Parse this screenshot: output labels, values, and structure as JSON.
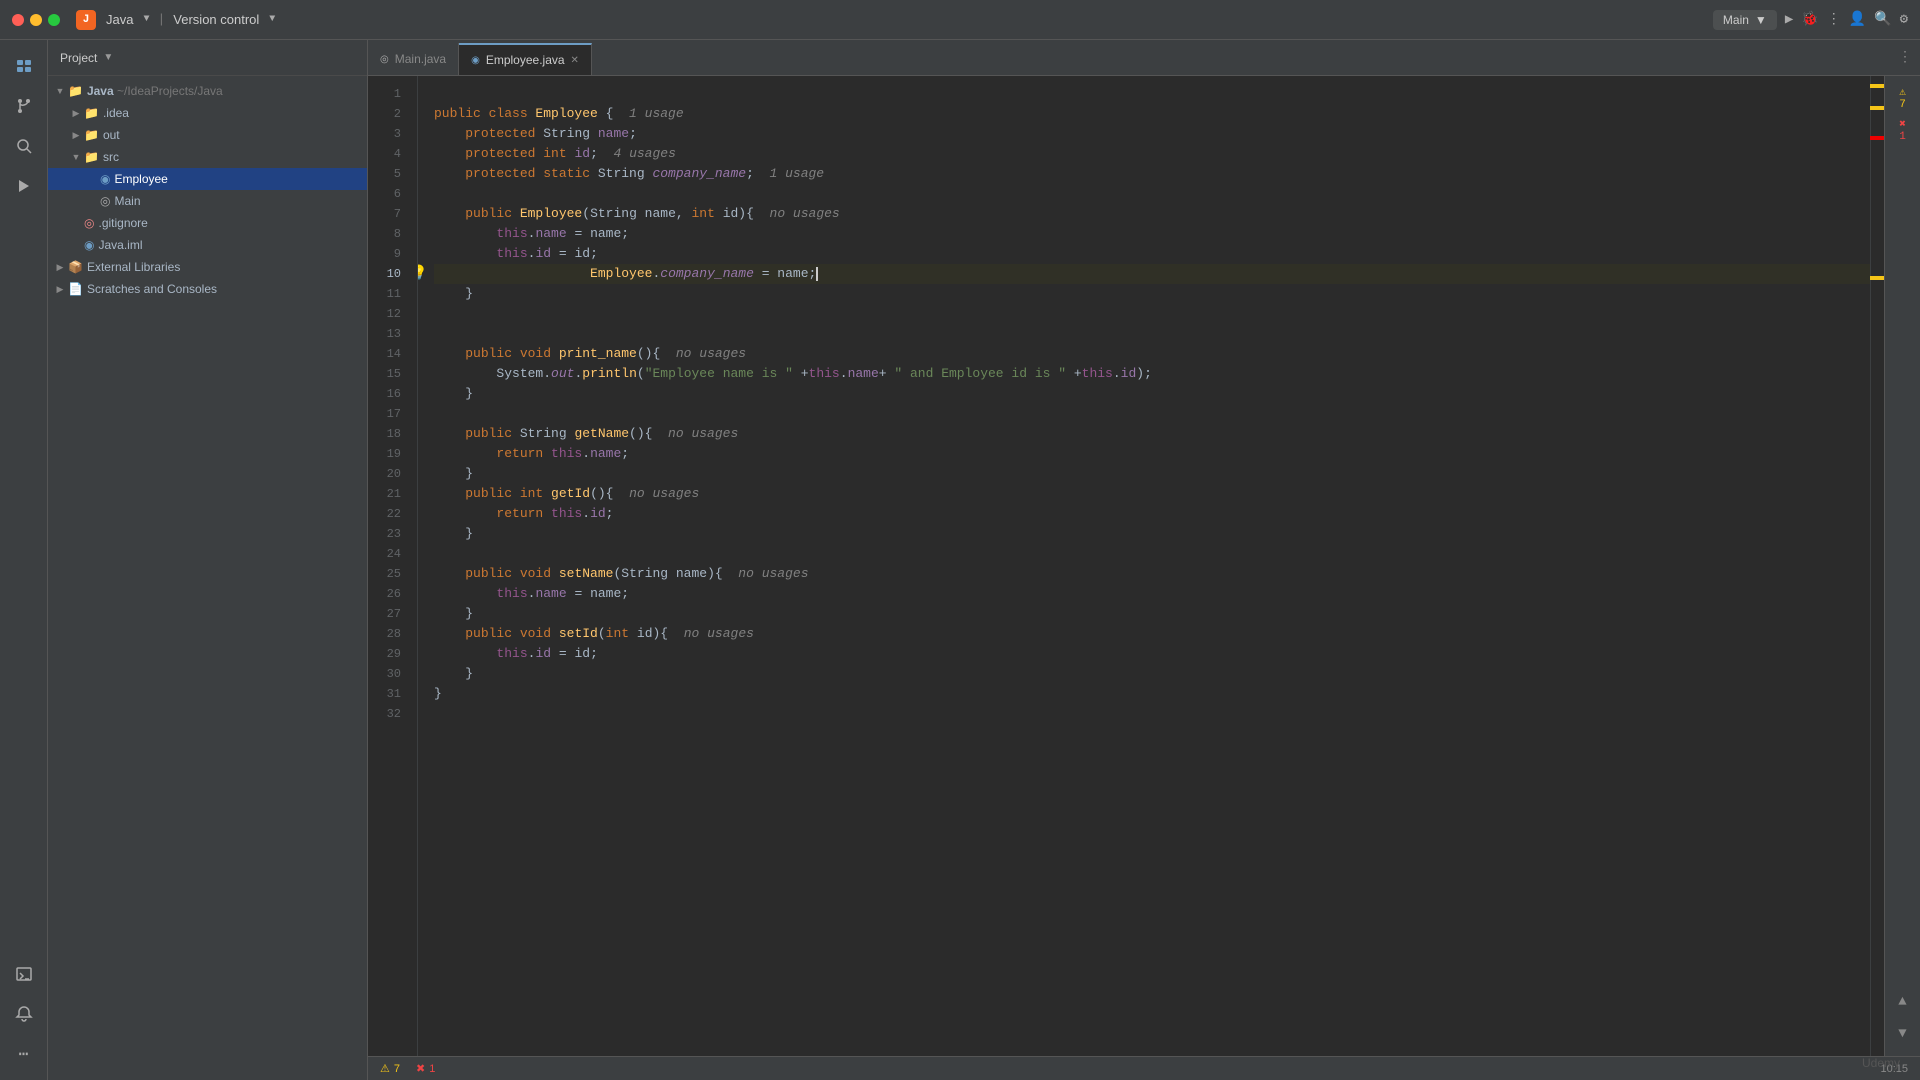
{
  "titlebar": {
    "app_icon": "J",
    "app_name": "Java",
    "version_control": "Version control",
    "branch": "Main",
    "run_label": "Main"
  },
  "project": {
    "title": "Project",
    "root": "Java",
    "root_path": "~/IdeaProjects/Java",
    "items": [
      {
        "label": ".idea",
        "type": "folder",
        "depth": 1,
        "expanded": false
      },
      {
        "label": "out",
        "type": "folder",
        "depth": 1,
        "expanded": false
      },
      {
        "label": "src",
        "type": "folder",
        "depth": 1,
        "expanded": true,
        "selected": false
      },
      {
        "label": "Employee",
        "type": "java",
        "depth": 2,
        "selected": true
      },
      {
        "label": "Main",
        "type": "java",
        "depth": 2,
        "selected": false
      },
      {
        "label": ".gitignore",
        "type": "git",
        "depth": 1,
        "selected": false
      },
      {
        "label": "Java.iml",
        "type": "iml",
        "depth": 1,
        "selected": false
      },
      {
        "label": "External Libraries",
        "type": "folder-ext",
        "depth": 0,
        "expanded": false
      },
      {
        "label": "Scratches and Consoles",
        "type": "scratch",
        "depth": 0,
        "expanded": false
      }
    ]
  },
  "tabs": [
    {
      "label": "Main.java",
      "active": false,
      "closable": false,
      "icon": "java"
    },
    {
      "label": "Employee.java",
      "active": true,
      "closable": true,
      "icon": "java"
    }
  ],
  "code": {
    "lines": [
      {
        "num": 1,
        "content": ""
      },
      {
        "num": 2,
        "content": "public class Employee {  1 usage"
      },
      {
        "num": 3,
        "content": "    protected String name;"
      },
      {
        "num": 4,
        "content": "    protected int id;  4 usages"
      },
      {
        "num": 5,
        "content": "    protected static String company_name;  1 usage"
      },
      {
        "num": 6,
        "content": ""
      },
      {
        "num": 7,
        "content": "    public Employee(String name, int id){  no usages"
      },
      {
        "num": 8,
        "content": "        this.name = name;"
      },
      {
        "num": 9,
        "content": "        this.id = id;"
      },
      {
        "num": 10,
        "content": "        Employee.company_name = name;"
      },
      {
        "num": 11,
        "content": "    }"
      },
      {
        "num": 12,
        "content": ""
      },
      {
        "num": 13,
        "content": ""
      },
      {
        "num": 14,
        "content": "    public void print_name(){  no usages"
      },
      {
        "num": 15,
        "content": "        System.out.println(\"Employee name is \" +this.name+ \" and Employee id is \" +this.id);"
      },
      {
        "num": 16,
        "content": "    }"
      },
      {
        "num": 17,
        "content": ""
      },
      {
        "num": 18,
        "content": "    public String getName(){  no usages"
      },
      {
        "num": 19,
        "content": "        return this.name;"
      },
      {
        "num": 20,
        "content": "    }"
      },
      {
        "num": 21,
        "content": "    public int getId(){  no usages"
      },
      {
        "num": 22,
        "content": "        return this.id;"
      },
      {
        "num": 23,
        "content": "    }"
      },
      {
        "num": 24,
        "content": ""
      },
      {
        "num": 25,
        "content": "    public void setName(String name){  no usages"
      },
      {
        "num": 26,
        "content": "        this.name = name;"
      },
      {
        "num": 27,
        "content": "    }"
      },
      {
        "num": 28,
        "content": "    public void setId(int id){  no usages"
      },
      {
        "num": 29,
        "content": "        this.id = id;"
      },
      {
        "num": 30,
        "content": "    }"
      },
      {
        "num": 31,
        "content": "}"
      },
      {
        "num": 32,
        "content": ""
      }
    ]
  },
  "status": {
    "warnings": "7",
    "errors": "1",
    "cursor_pos": "10:15"
  },
  "watermark": "Udemy"
}
